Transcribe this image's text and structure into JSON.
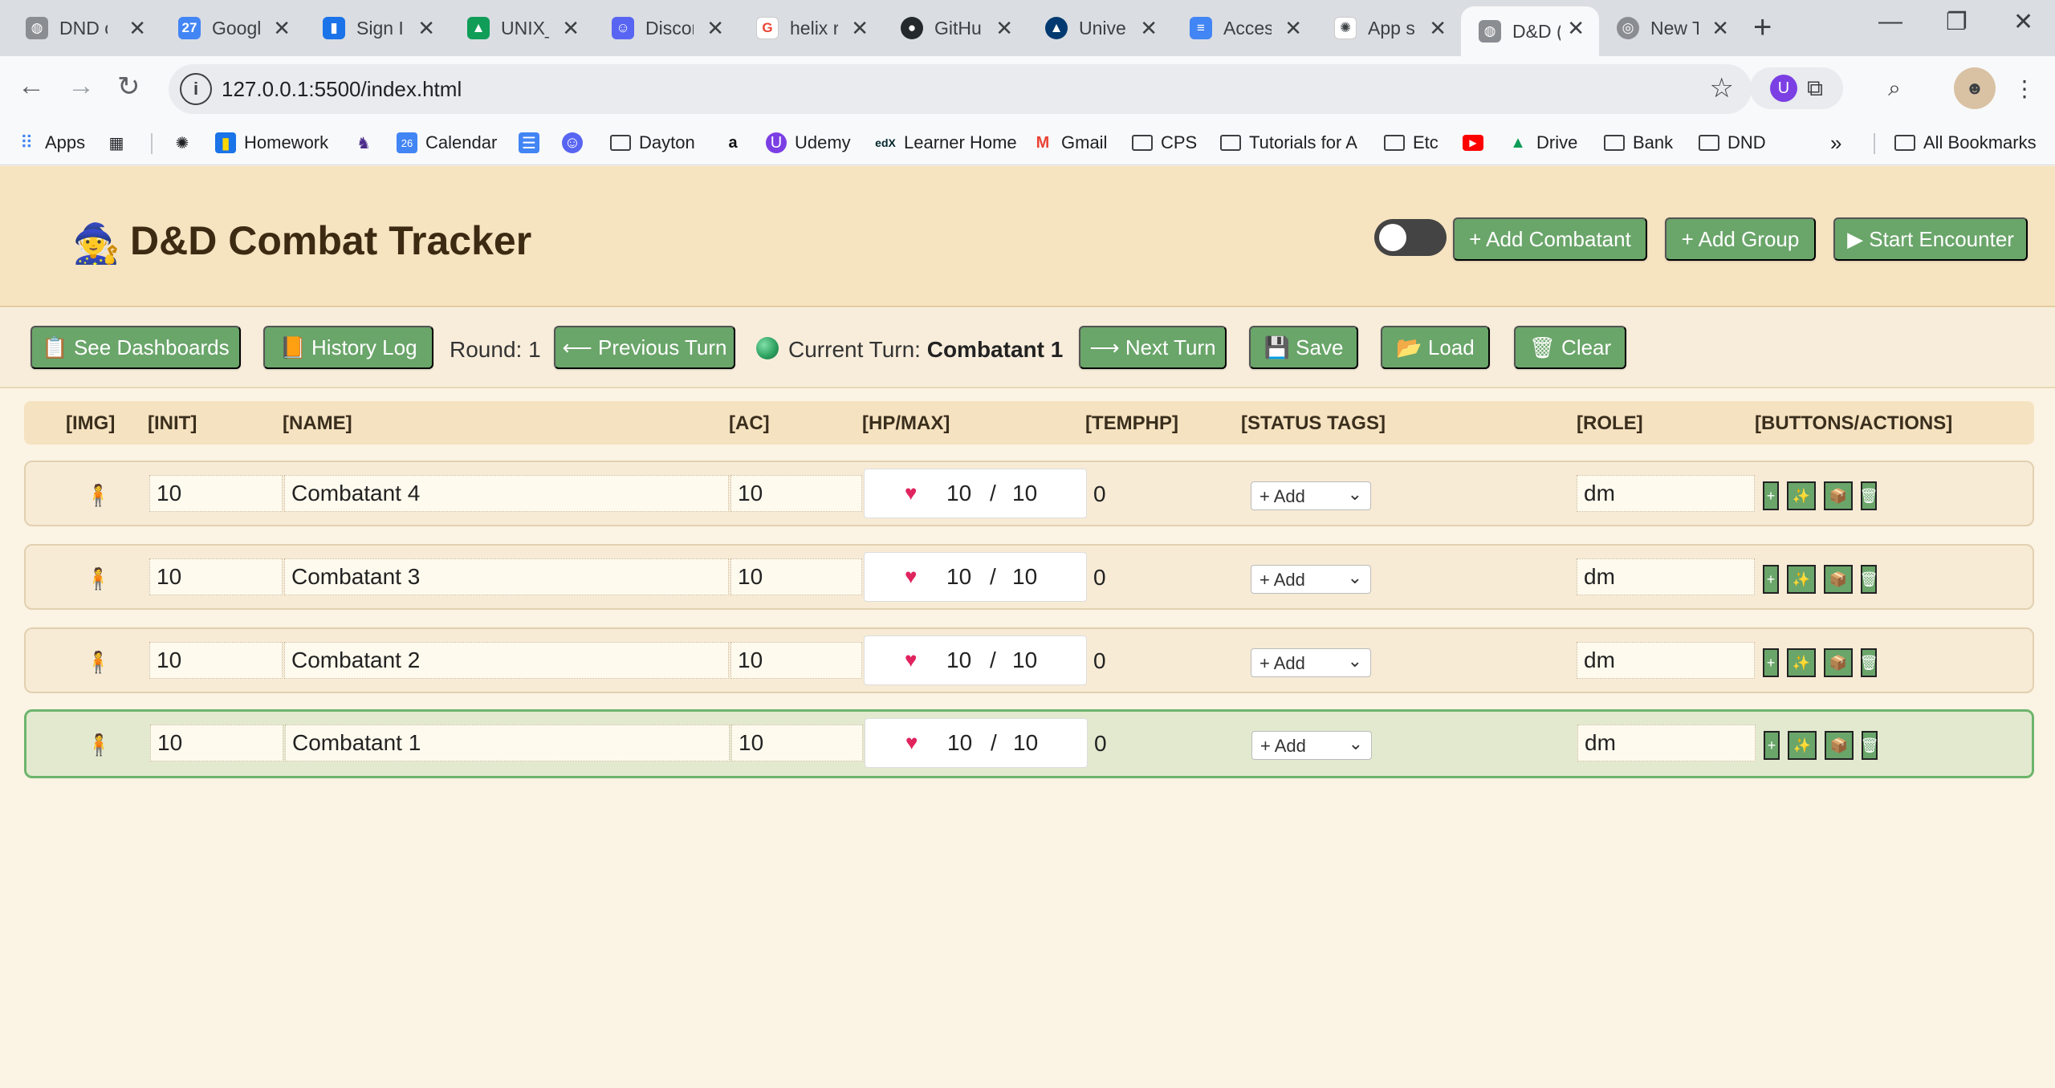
{
  "browser": {
    "tabs": [
      {
        "title": "DND c",
        "favicon": "globe-icon",
        "color": "#5f6368"
      },
      {
        "title": "Googl",
        "favicon": "google-calendar-icon",
        "color": "#4285f4"
      },
      {
        "title": "Sign I",
        "favicon": "bookmark-icon",
        "color": "#1a73e8"
      },
      {
        "title": "UNIX_",
        "favicon": "google-drive-icon",
        "color": "#0f9d58"
      },
      {
        "title": "Discor",
        "favicon": "discord-icon",
        "color": "#5865f2"
      },
      {
        "title": "helix r",
        "favicon": "google-icon",
        "color": "#ea4335"
      },
      {
        "title": "GitHu",
        "favicon": "github-icon",
        "color": "#24292e"
      },
      {
        "title": "Unive",
        "favicon": "university-icon",
        "color": "#003a70"
      },
      {
        "title": "Acces",
        "favicon": "google-docs-icon",
        "color": "#4285f4"
      },
      {
        "title": "App s",
        "favicon": "openai-icon",
        "color": "#3c4043"
      },
      {
        "title": "D&D (",
        "favicon": "globe-icon",
        "color": "#5f6368"
      },
      {
        "title": "New T",
        "favicon": "chrome-icon",
        "color": "#5f6368"
      }
    ],
    "url": "127.0.0.1:5500/index.html",
    "bookmarks": [
      {
        "label": "Apps",
        "icon": "apps-grid-icon"
      },
      {
        "label": "",
        "icon": "tab-groups-icon"
      },
      {
        "label": "",
        "icon": "openai-icon"
      },
      {
        "label": "Homework",
        "icon": "bookmark-icon"
      },
      {
        "label": "",
        "icon": "wolf-icon"
      },
      {
        "label": "Calendar",
        "icon": "google-calendar-icon"
      },
      {
        "label": "",
        "icon": "forms-icon"
      },
      {
        "label": "",
        "icon": "discord-icon"
      },
      {
        "label": "Dayton",
        "icon": "folder-icon"
      },
      {
        "label": "",
        "icon": "amazon-icon"
      },
      {
        "label": "Udemy",
        "icon": "udemy-icon"
      },
      {
        "label": "Learner Home",
        "icon": "edx-icon"
      },
      {
        "label": "Gmail",
        "icon": "gmail-icon"
      },
      {
        "label": "CPS",
        "icon": "folder-icon"
      },
      {
        "label": "Tutorials for A",
        "icon": "folder-icon"
      },
      {
        "label": "Etc",
        "icon": "folder-icon"
      },
      {
        "label": "",
        "icon": "youtube-icon"
      },
      {
        "label": "Drive",
        "icon": "google-drive-icon"
      },
      {
        "label": "Bank",
        "icon": "folder-icon"
      },
      {
        "label": "DND",
        "icon": "folder-icon"
      }
    ],
    "more_bookmarks": "»",
    "all_bookmarks": "All Bookmarks"
  },
  "app": {
    "title": "D&D Combat Tracker",
    "logo_emoji": "🧙",
    "header_buttons": {
      "add_combatant": "+ Add Combatant",
      "add_group": "+ Add Group",
      "start_encounter": "▶ Start Encounter"
    },
    "controls": {
      "see_dashboards": "📋 See Dashboards",
      "history_log": "📙 History Log",
      "round_label": "Round: 1",
      "previous_turn": "⟵ Previous Turn",
      "current_turn_label": "Current Turn:",
      "current_turn_name": "Combatant 1",
      "next_turn": "⟶ Next Turn",
      "save": "💾 Save",
      "load": "📂 Load",
      "clear": "🗑 Clear"
    },
    "columns": [
      "[IMG]",
      "[INIT]",
      "[NAME]",
      "[AC]",
      "[HP/MAX]",
      "[TEMPHP]",
      "[STATUS TAGS]",
      "[ROLE]",
      "[BUTTONS/ACTIONS]"
    ],
    "combatants": [
      {
        "img": "🧍",
        "init": "10",
        "name": "Combatant 4",
        "ac": "10",
        "hp": "10",
        "hp_sep": "/",
        "max_hp": "10",
        "temp_hp": "0",
        "status": "+ Add",
        "role": "dm",
        "active": false
      },
      {
        "img": "🧍",
        "init": "10",
        "name": "Combatant 3",
        "ac": "10",
        "hp": "10",
        "hp_sep": "/",
        "max_hp": "10",
        "temp_hp": "0",
        "status": "+ Add",
        "role": "dm",
        "active": false
      },
      {
        "img": "🧍",
        "init": "10",
        "name": "Combatant 2",
        "ac": "10",
        "hp": "10",
        "hp_sep": "/",
        "max_hp": "10",
        "temp_hp": "0",
        "status": "+ Add",
        "role": "dm",
        "active": false
      },
      {
        "img": "🧍",
        "init": "10",
        "name": "Combatant 1",
        "ac": "10",
        "hp": "10",
        "hp_sep": "/",
        "max_hp": "10",
        "temp_hp": "0",
        "status": "+ Add",
        "role": "dm",
        "active": true
      }
    ],
    "row_action_icons": [
      "+",
      "✨",
      "📦",
      "🗑"
    ],
    "colors": {
      "button_green": "#6aa56a",
      "header_bg": "#f6e3c0",
      "active_row_border": "#6cb56c"
    }
  }
}
